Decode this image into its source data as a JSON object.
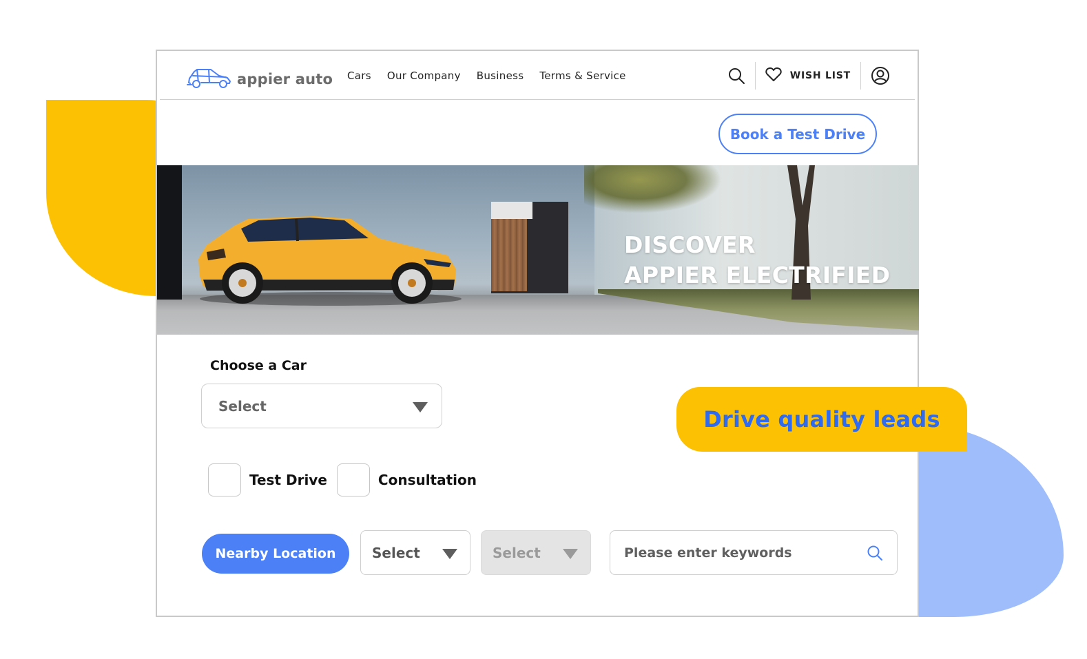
{
  "brand": {
    "name": "appier auto",
    "logo_icon": "car-outline-icon",
    "accent_color": "#4b80f7",
    "highlight_color": "#fdc104",
    "decor_blue": "#a0bdfb"
  },
  "nav": {
    "items": [
      {
        "label": "Cars"
      },
      {
        "label": "Our Company"
      },
      {
        "label": "Business"
      },
      {
        "label": "Terms & Service"
      }
    ]
  },
  "header_actions": {
    "search_icon": "search-icon",
    "wishlist_icon": "heart-icon",
    "wishlist_label": "WISH LIST",
    "account_icon": "user-circle-icon"
  },
  "cta": {
    "book_test_drive": "Book a Test Drive"
  },
  "hero": {
    "title_line1": "DISCOVER",
    "title_line2": "APPIER ELECTRIFIED",
    "image_description": "Yellow compact SUV parked beside a modern wall with tree"
  },
  "form": {
    "choose_car_label": "Choose a Car",
    "car_select": {
      "value": "Select"
    },
    "checkboxes": [
      {
        "label": "Test Drive",
        "checked": false
      },
      {
        "label": "Consultation",
        "checked": false
      }
    ],
    "nearby_location_label": "Nearby Location",
    "region_select": {
      "value": "Select",
      "disabled": false
    },
    "city_select": {
      "value": "Select",
      "disabled": true
    },
    "keyword_search": {
      "placeholder": "Please enter keywords",
      "value": ""
    }
  },
  "callout": {
    "text": "Drive quality leads"
  }
}
